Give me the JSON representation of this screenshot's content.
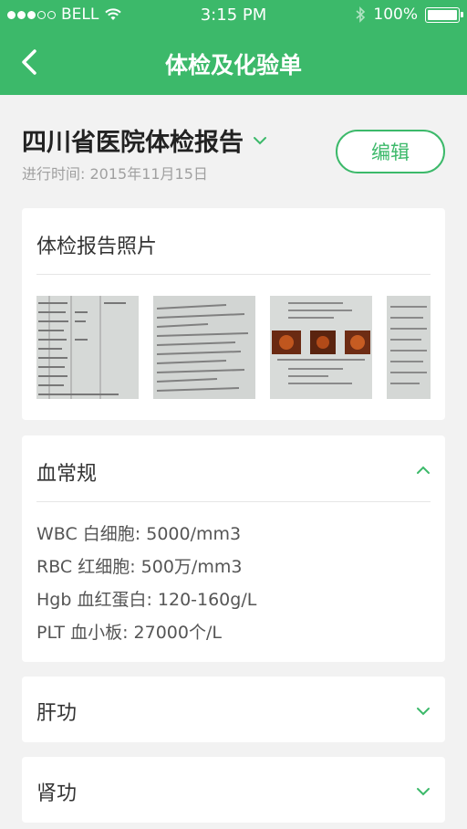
{
  "status_bar": {
    "carrier": "BELL",
    "time": "3:15 PM",
    "battery": "100%"
  },
  "nav": {
    "title": "体检及化验单",
    "back_icon": "chevron-left-icon"
  },
  "report": {
    "title": "四川省医院体检报告",
    "time_label": "进行时间: 2015年11月15日",
    "edit_label": "编辑"
  },
  "photos": {
    "title": "体检报告照片",
    "count_visible": 4
  },
  "blood": {
    "title": "血常规",
    "items": [
      "WBC 白细胞: 5000/mm3",
      "RBC  红细胞: 500万/mm3",
      "Hgb 血红蛋白: 120-160g/L",
      "PLT 血小板: 27000个/L"
    ],
    "expanded": true
  },
  "liver": {
    "title": "肝功",
    "expanded": false
  },
  "kidney": {
    "title": "肾功",
    "expanded": false
  },
  "colors": {
    "accent": "#3cb96a",
    "background": "#f2f2f2",
    "card": "#ffffff"
  }
}
